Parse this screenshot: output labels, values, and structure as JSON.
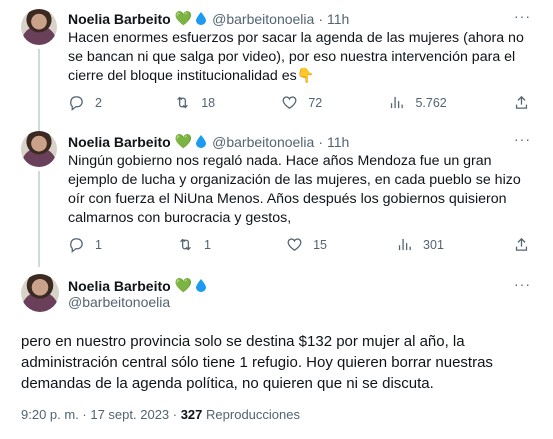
{
  "tweets": [
    {
      "author": "Noelia Barbeito",
      "heart": "💚",
      "handle": "@barbeitonoelia",
      "time": "11h",
      "more": "···",
      "text": "Hacen enormes esfuerzos por sacar la agenda de las mujeres (ahora no se bancan ni que salga por video), por eso nuestra intervención para el cierre del bloque institucionalidad es👇",
      "replies": "2",
      "retweets": "18",
      "likes": "72",
      "views": "5.762"
    },
    {
      "author": "Noelia Barbeito",
      "heart": "💚",
      "handle": "@barbeitonoelia",
      "time": "11h",
      "more": "···",
      "text": "Ningún gobierno nos regaló nada. Hace años Mendoza fue un gran ejemplo de lucha y organización de las mujeres, en cada pueblo se hizo oír con fuerza el NiUna Menos. Años después los gobiernos quisieron calmarnos con burocracia y gestos,",
      "replies": "1",
      "retweets": "1",
      "likes": "15",
      "views": "301"
    }
  ],
  "main_tweet": {
    "author": "Noelia Barbeito",
    "heart": "💚",
    "handle": "@barbeitonoelia",
    "more": "···",
    "text": "pero en nuestro provincia solo se destina $132 por mujer al año, la administración central sólo tiene 1 refugio. Hoy quieren borrar nuestras demandas de la agenda política, no quieren que ni se discuta.",
    "timestamp": "9:20 p. m. · 17 sept. 2023 · ",
    "views_count": "327",
    "views_label": "Reproducciones"
  },
  "colors": {
    "text": "#0f1419",
    "secondary": "#536471",
    "heart": "#3a9a3a",
    "drop": "#1d9bf0",
    "divider": "#eff3f4"
  },
  "icons": [
    "reply-icon",
    "retweet-icon",
    "like-icon",
    "views-icon",
    "share-icon",
    "more-icon",
    "water-drop-icon"
  ]
}
